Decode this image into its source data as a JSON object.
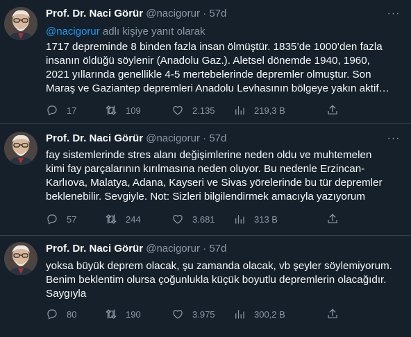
{
  "tweets": [
    {
      "name": "Prof. Dr. Naci Görür",
      "handle": "@nacigorur",
      "sep": "·",
      "time": "57d",
      "more": "···",
      "reply_mention": "@nacigorur",
      "reply_suffix": " adlı kişiye yanıt olarak",
      "lines": [
        "1717 depreminde 8 binden fazla insan ölmüştür. 1835’de 1000’den fazla",
        "insanın öldüğü söylenir (Anadolu Gaz.). Aletsel dönemde 1940, 1960,",
        "2021 yıllarında genellikle 4-5 mertebelerinde depremler olmuştur. Son",
        "Maraş ve Gaziantep depremleri Anadolu Levhasının bölgeye yakın aktif…"
      ],
      "stats": {
        "replies": "17",
        "retweets": "109",
        "likes": "2.135",
        "views": "219,3 B"
      }
    },
    {
      "name": "Prof. Dr. Naci Görür",
      "handle": "@nacigorur",
      "sep": "·",
      "time": "57d",
      "more": "···",
      "lines": [
        "fay sistemlerinde stres alanı değişimlerine neden oldu ve muhtemelen",
        "kimi fay parçalarının kırılmasına neden oluyor. Bu nedenle Erzincan-",
        "Karlıova, Malatya, Adana, Kayseri ve Sivas yörelerinde bu tür depremler",
        "beklenebilir. Sevgiyle. Not: Sizleri bilgilendirmek amacıyla yazıyorum"
      ],
      "stats": {
        "replies": "57",
        "retweets": "244",
        "likes": "3.681",
        "views": "313 B"
      }
    },
    {
      "name": "Prof. Dr. Naci Görür",
      "handle": "@nacigorur",
      "sep": "·",
      "time": "57d",
      "lines": [
        "yoksa büyük deprem olacak, şu zamanda olacak, vb şeyler söylemiyorum.",
        "Benim beklentim olursa çoğunlukla küçük boyutlu depremlerin olacağıdır.",
        "Saygıyla"
      ],
      "stats": {
        "replies": "80",
        "retweets": "190",
        "likes": "3.975",
        "views": "300,2 B"
      }
    }
  ],
  "icons": {
    "reply": "reply-icon",
    "retweet": "retweet-icon",
    "like": "heart-icon",
    "views": "views-chart-icon",
    "share": "share-icon",
    "more": "more-icon"
  },
  "colors": {
    "background": "#15202b",
    "text": "#f7f9f9",
    "secondary": "#8b98a5",
    "link": "#1d9bf0",
    "divider": "#38444d"
  }
}
